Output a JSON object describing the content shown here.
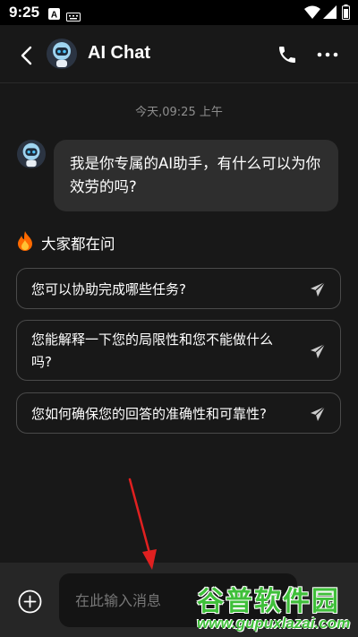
{
  "status_bar": {
    "time": "9:25",
    "icons": [
      "text-a-icon",
      "keyboard-icon",
      "wifi-icon",
      "signal-icon",
      "battery-icon"
    ]
  },
  "header": {
    "title": "AI Chat",
    "icons": [
      "back-arrow-icon",
      "robot-avatar-icon",
      "phone-icon",
      "more-dots-icon"
    ]
  },
  "chat": {
    "timestamp": "今天,09:25 上午",
    "messages": [
      {
        "sender": "bot",
        "text": "我是你专属的AI助手，有什么可以为你效劳的吗?"
      }
    ]
  },
  "faq": {
    "title": "大家都在问",
    "title_icon": "fire-icon",
    "items": [
      {
        "text": "您可以协助完成哪些任务?"
      },
      {
        "text": "您能解释一下您的局限性和您不能做什么吗?"
      },
      {
        "text": "您如何确保您的回答的准确性和可靠性?"
      }
    ]
  },
  "input_bar": {
    "placeholder": "在此输入消息",
    "add_icon": "plus-circle-icon"
  },
  "watermark": {
    "title": "谷普软件园",
    "url": "www.gupuxlazai.com"
  },
  "colors": {
    "background": "#181818",
    "bubble": "#2e2e2e",
    "input_bar": "#262626",
    "annotation_arrow": "#e02020",
    "watermark": "#3fbf3a"
  }
}
